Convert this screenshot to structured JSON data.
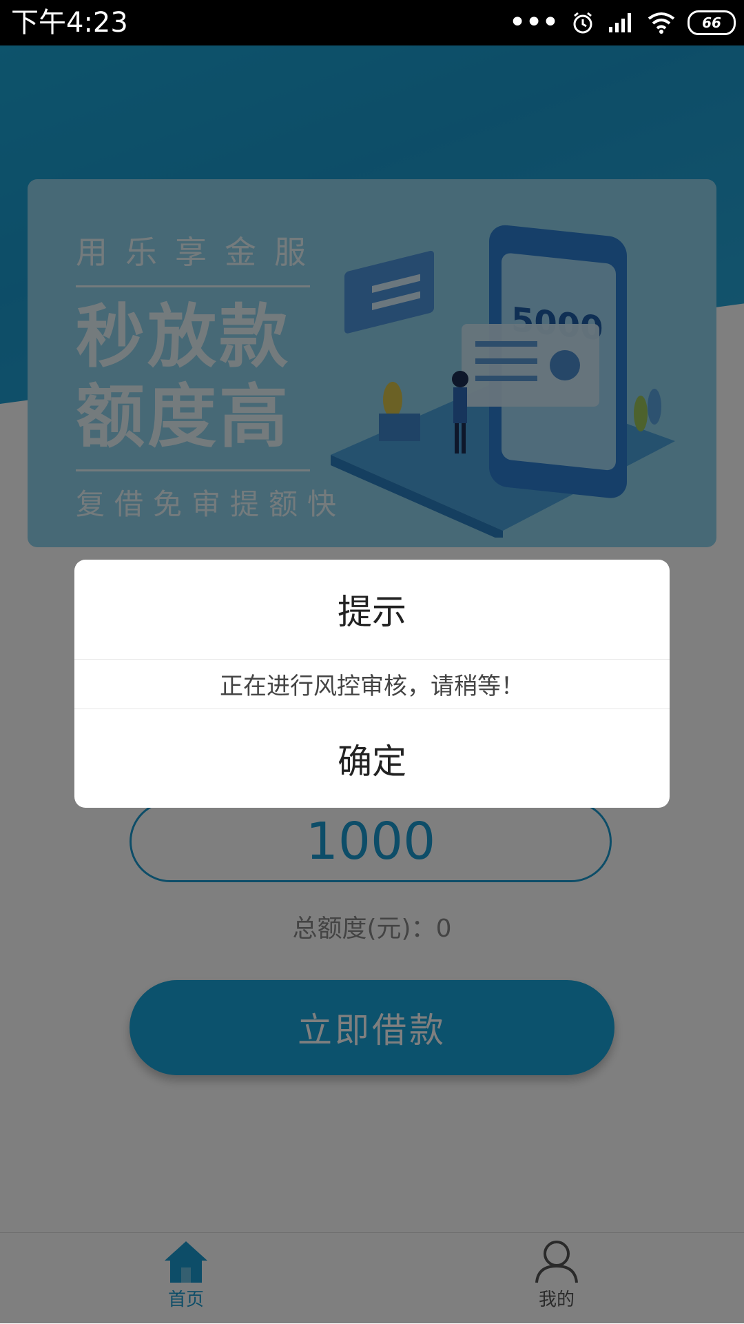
{
  "status_bar": {
    "time": "下午4:23",
    "battery": "66"
  },
  "banner": {
    "subtitle_top": "用乐享金服",
    "headline_line1": "秒放款",
    "headline_line2": "额度高",
    "subtitle_bottom": "复借免审提额快",
    "phone_amount": "5000"
  },
  "loan": {
    "amount": "1000",
    "total_label": "总额度(元)：0",
    "borrow_button": "立即借款"
  },
  "tabs": [
    {
      "label": "首页",
      "icon": "home-icon",
      "active": true
    },
    {
      "label": "我的",
      "icon": "person-icon",
      "active": false
    }
  ],
  "dialog": {
    "title": "提示",
    "message": "正在进行风控审核，请稍等！",
    "confirm": "确定"
  },
  "colors": {
    "accent": "#1b9bd0",
    "overlay": "rgba(0,0,0,0.5)"
  }
}
